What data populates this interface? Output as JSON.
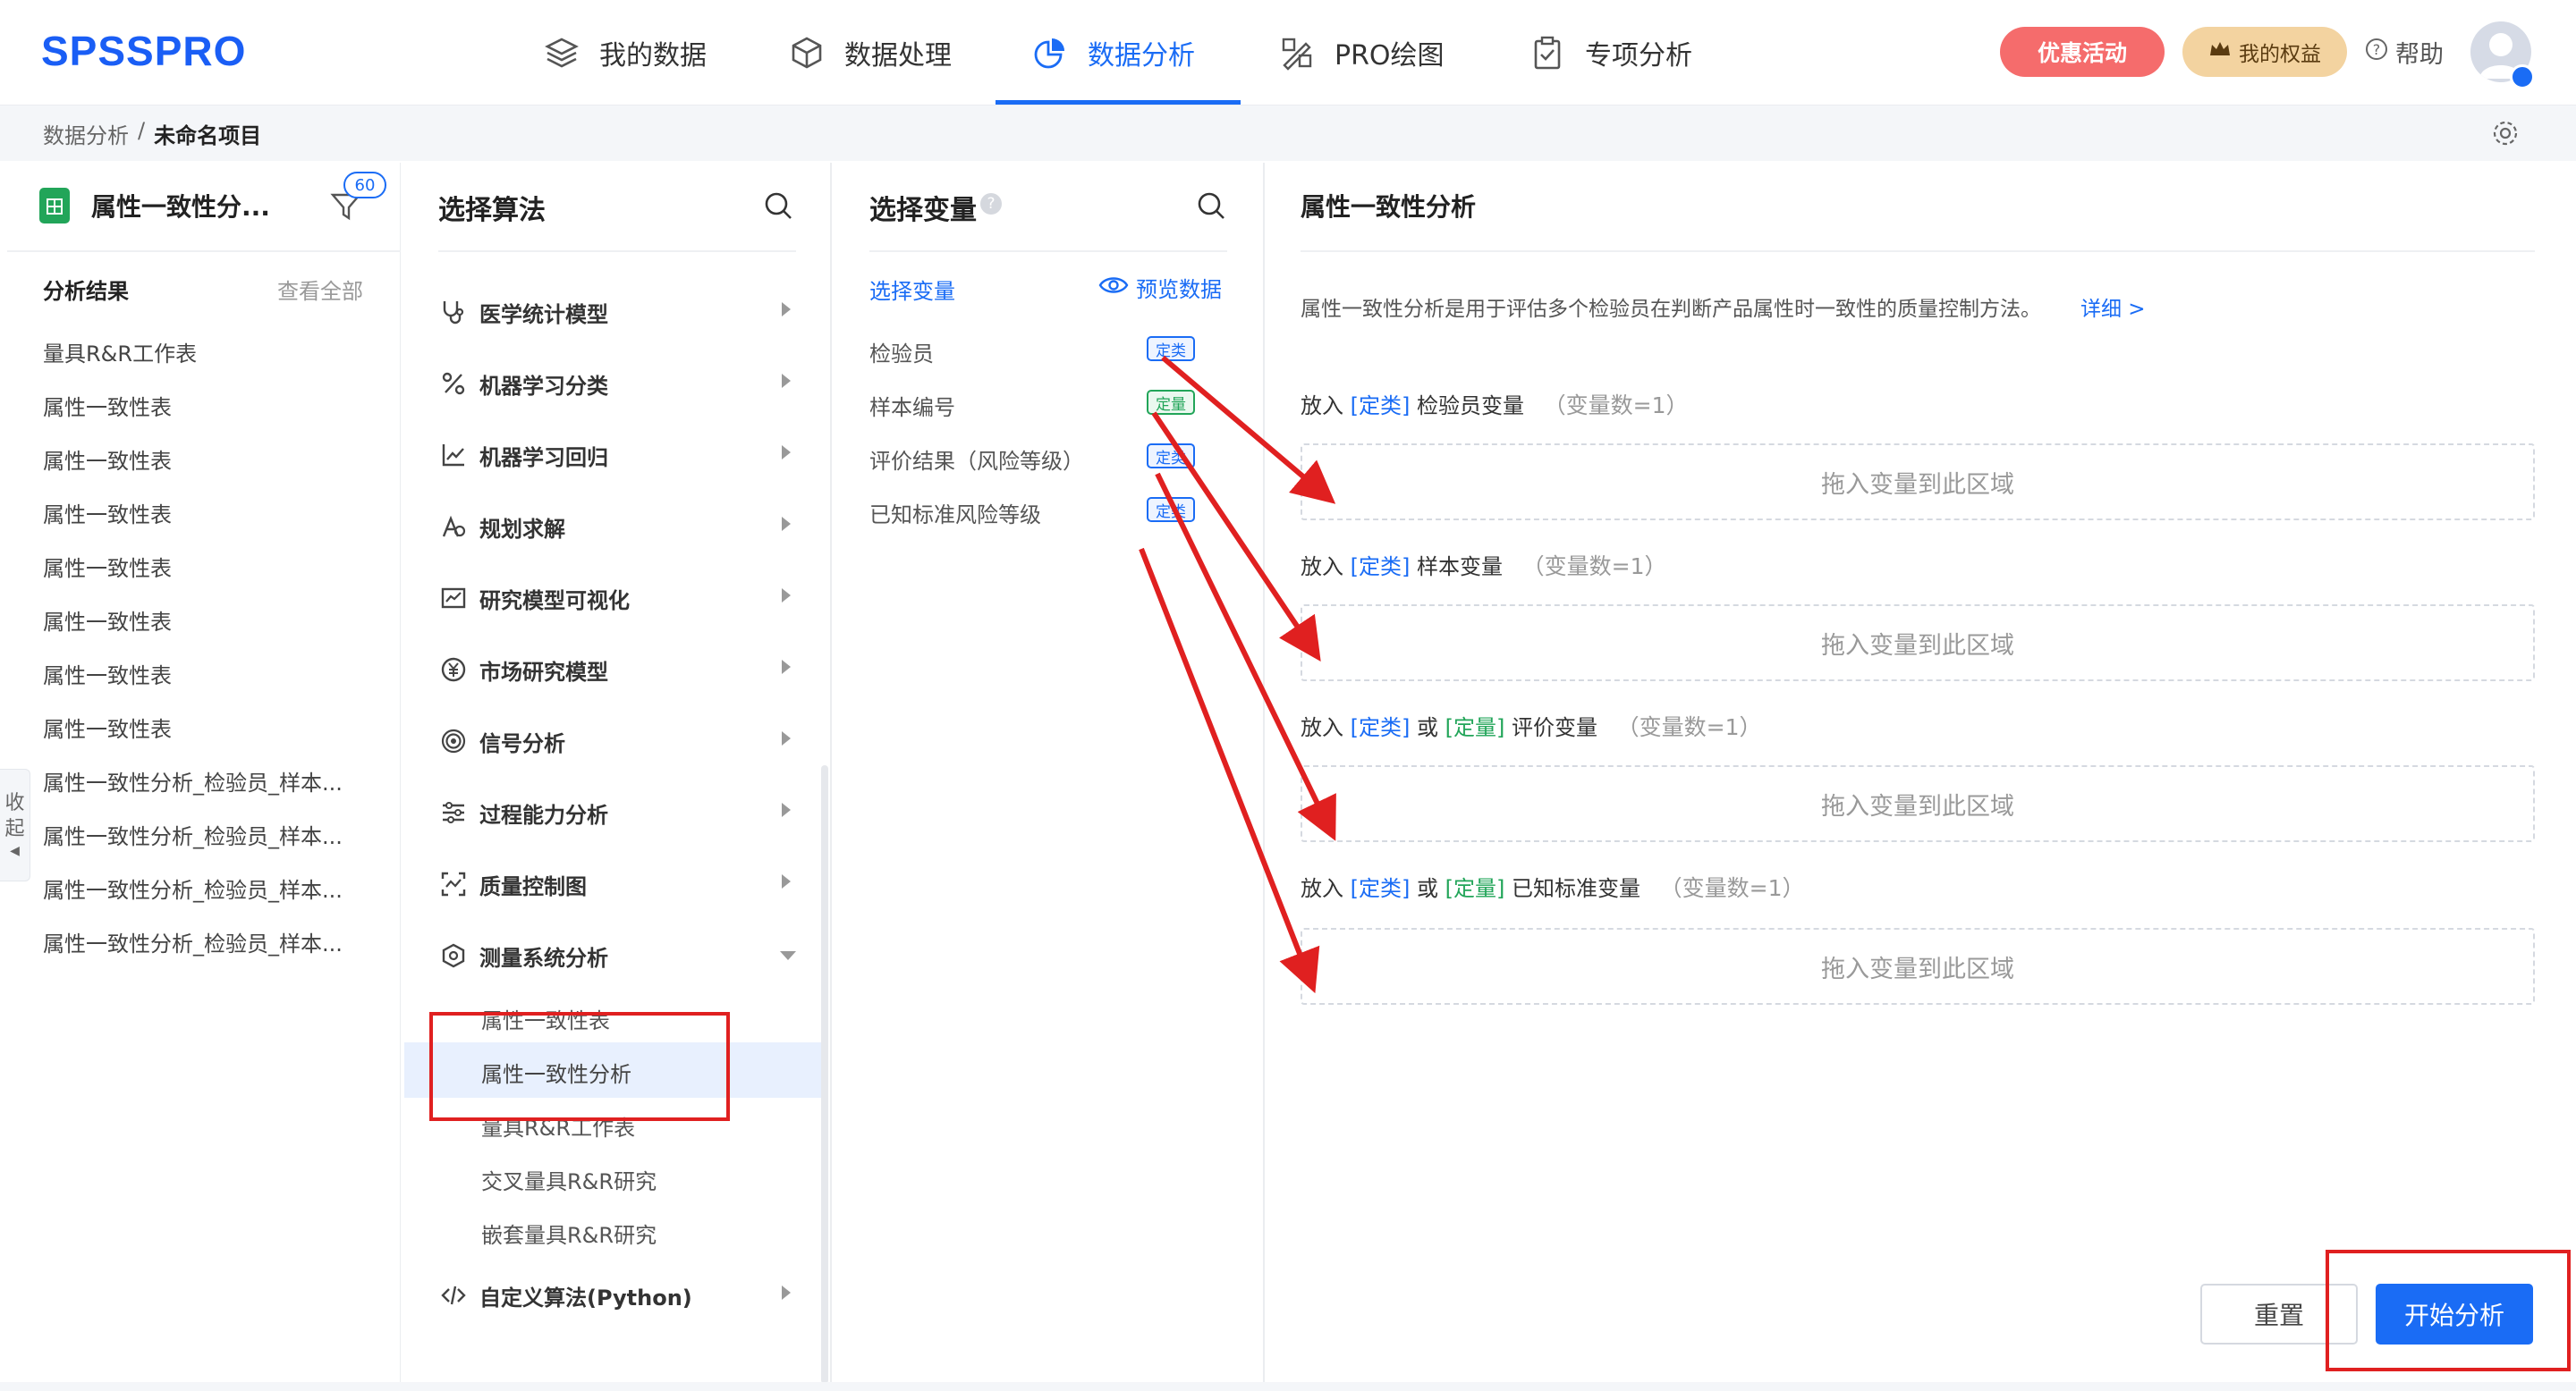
{
  "header": {
    "logo": "SPSSPRO",
    "nav": [
      {
        "label": "我的数据",
        "icon": "layers-icon"
      },
      {
        "label": "数据处理",
        "icon": "cube-icon"
      },
      {
        "label": "数据分析",
        "icon": "pie-chart-icon",
        "active": true
      },
      {
        "label": "PRO绘图",
        "icon": "drawing-tools-icon"
      },
      {
        "label": "专项分析",
        "icon": "clipboard-check-icon"
      }
    ],
    "promo_label": "优惠活动",
    "rights_label": "我的权益",
    "help_label": "帮助",
    "accent_color": "#1a6cf5"
  },
  "breadcrumb": {
    "parent": "数据分析",
    "separator": "/",
    "current": "未命名项目"
  },
  "left_panel": {
    "project_title": "属性一致性分...",
    "filter_count": "60",
    "results_heading": "分析结果",
    "view_all": "查看全部",
    "history": [
      "量具R&R工作表",
      "属性一致性表",
      "属性一致性表",
      "属性一致性表",
      "属性一致性表",
      "属性一致性表",
      "属性一致性表",
      "属性一致性表",
      "属性一致性分析_检验员_样本...",
      "属性一致性分析_检验员_样本...",
      "属性一致性分析_检验员_样本...",
      "属性一致性分析_检验员_样本..."
    ],
    "collapse_label_1": "收",
    "collapse_label_2": "起"
  },
  "algorithm_panel": {
    "title": "选择算法",
    "categories": [
      {
        "label": "医学统计模型",
        "icon": "stethoscope-icon"
      },
      {
        "label": "机器学习分类",
        "icon": "percent-icon"
      },
      {
        "label": "机器学习回归",
        "icon": "line-chart-icon"
      },
      {
        "label": "规划求解",
        "icon": "planning-icon"
      },
      {
        "label": "研究模型可视化",
        "icon": "visual-chart-icon"
      },
      {
        "label": "市场研究模型",
        "icon": "yen-coin-icon"
      },
      {
        "label": "信号分析",
        "icon": "signal-icon"
      },
      {
        "label": "过程能力分析",
        "icon": "sliders-icon"
      },
      {
        "label": "质量控制图",
        "icon": "control-chart-icon"
      },
      {
        "label": "测量系统分析",
        "icon": "measure-icon",
        "expanded": true
      }
    ],
    "subitems": [
      "属性一致性表",
      "属性一致性分析",
      "量具R&R工作表",
      "交叉量具R&R研究",
      "嵌套量具R&R研究"
    ],
    "active_subitem": "属性一致性分析",
    "last_category": {
      "label": "自定义算法(Python)",
      "icon": "code-icon"
    }
  },
  "variable_panel": {
    "title": "选择变量",
    "select_label": "选择变量",
    "preview_label": "预览数据",
    "variables": [
      {
        "name": "检验员",
        "tag": "定类",
        "kind": "categorical"
      },
      {
        "name": "样本编号",
        "tag": "定量",
        "kind": "quantitative"
      },
      {
        "name": "评价结果（风险等级）",
        "tag": "定类",
        "kind": "categorical"
      },
      {
        "name": "已知标准风险等级",
        "tag": "定类",
        "kind": "categorical"
      }
    ]
  },
  "config_panel": {
    "title": "属性一致性分析",
    "description": "属性一致性分析是用于评估多个检验员在判断产品属性时一致性的质量控制方法。",
    "detail_link": "详细 >",
    "slots": [
      {
        "prefix": "放入",
        "type1": "[定类]",
        "or": "",
        "type2": "",
        "name": "检验员变量",
        "count": "（变量数=1）",
        "placeholder": "拖入变量到此区域"
      },
      {
        "prefix": "放入",
        "type1": "[定类]",
        "or": "",
        "type2": "",
        "name": "样本变量",
        "count": "（变量数=1）",
        "placeholder": "拖入变量到此区域"
      },
      {
        "prefix": "放入",
        "type1": "[定类]",
        "or": "或",
        "type2": "[定量]",
        "name": "评价变量",
        "count": "（变量数=1）",
        "placeholder": "拖入变量到此区域"
      },
      {
        "prefix": "放入",
        "type1": "[定类]",
        "or": "或",
        "type2": "[定量]",
        "name": "已知标准变量",
        "count": "（变量数=1）",
        "placeholder": "拖入变量到此区域"
      }
    ],
    "reset_label": "重置",
    "start_label": "开始分析"
  }
}
